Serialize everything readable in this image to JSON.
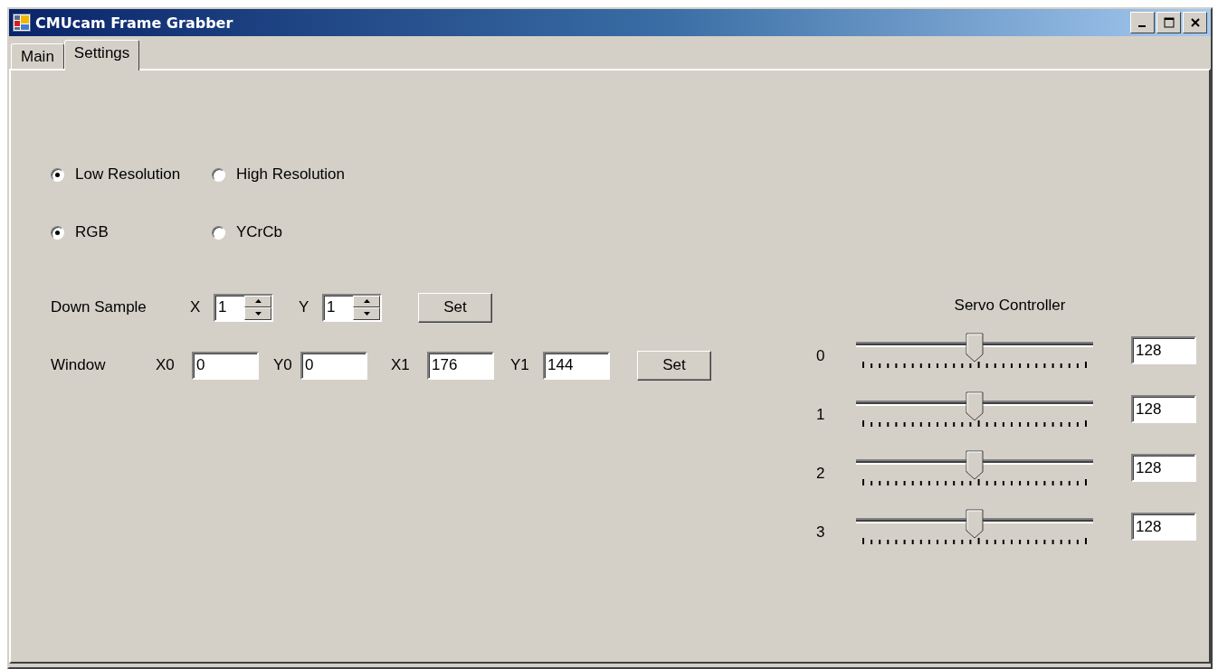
{
  "window": {
    "title": "CMUcam Frame Grabber"
  },
  "tabs": [
    {
      "label": "Main",
      "selected": false
    },
    {
      "label": "Settings",
      "selected": true
    }
  ],
  "resolution_options": [
    {
      "label": "Low Resolution",
      "selected": true
    },
    {
      "label": "High Resolution",
      "selected": false
    }
  ],
  "color_mode_options": [
    {
      "label": "RGB",
      "selected": true
    },
    {
      "label": "YCrCb",
      "selected": false
    }
  ],
  "down_sample": {
    "label": "Down Sample",
    "fields": [
      {
        "label": "X",
        "value": "1"
      },
      {
        "label": "Y",
        "value": "1"
      }
    ],
    "button": "Set"
  },
  "window_region": {
    "label": "Window",
    "fields": [
      {
        "label": "X0",
        "value": "0"
      },
      {
        "label": "Y0",
        "value": "0"
      },
      {
        "label": "X1",
        "value": "176"
      },
      {
        "label": "Y1",
        "value": "144"
      }
    ],
    "button": "Set"
  },
  "servo_controller": {
    "title": "Servo Controller",
    "servos": [
      {
        "label": "0",
        "level": 0.5,
        "value": "128"
      },
      {
        "label": "1",
        "level": 0.5,
        "value": "128"
      },
      {
        "label": "2",
        "level": 0.5,
        "value": "128"
      },
      {
        "label": "3",
        "level": 0.5,
        "value": "128"
      }
    ]
  }
}
